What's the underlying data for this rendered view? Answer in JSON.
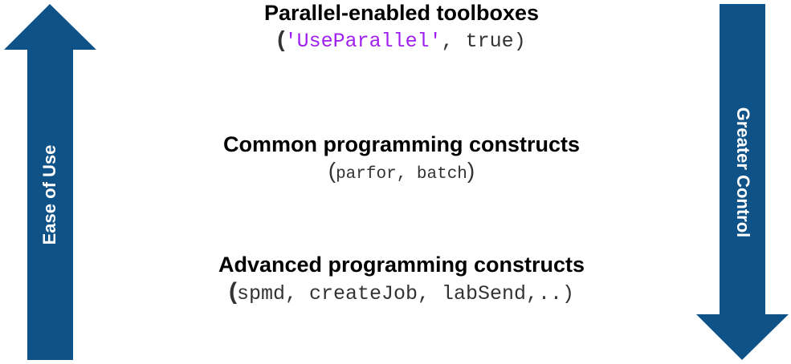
{
  "colors": {
    "arrow": "#0f5287",
    "arrow_text": "#ffffff",
    "string_literal": "#a020f0",
    "title_text": "#000000",
    "code_text": "#333333"
  },
  "left_arrow": {
    "direction": "up",
    "label": "Ease of Use"
  },
  "right_arrow": {
    "direction": "down",
    "label": "Greater Control"
  },
  "tiers": [
    {
      "title": "Parallel-enabled toolboxes",
      "open_paren": "(",
      "code_string": "'UseParallel'",
      "code_rest": ", true",
      "close_paren": ")"
    },
    {
      "title": "Common programming constructs",
      "open_paren": "(",
      "code": "parfor, batch",
      "close_paren": ")"
    },
    {
      "title": "Advanced programming constructs",
      "open_paren": "(",
      "code": "spmd, createJob, labSend,..",
      "close_paren": ")"
    }
  ]
}
